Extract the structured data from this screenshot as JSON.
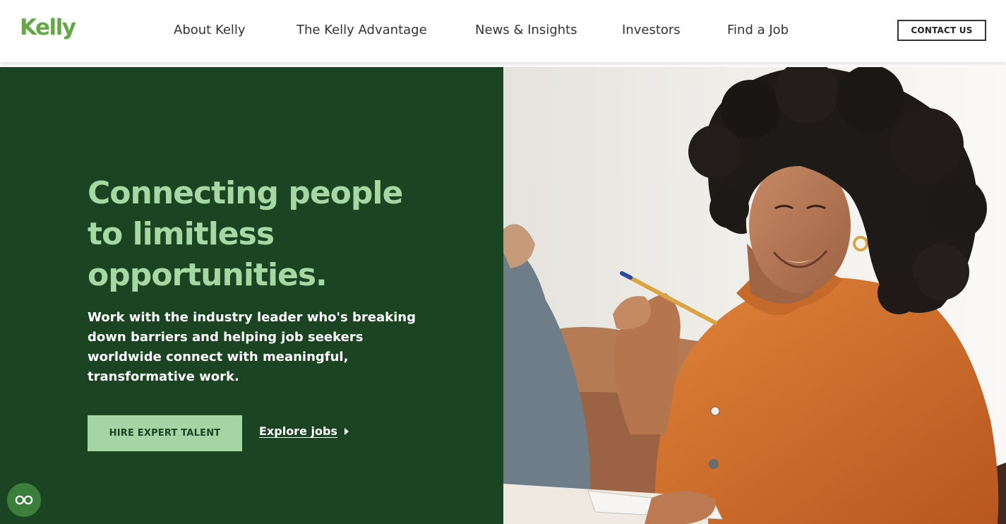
{
  "header": {
    "logo_text": "Kelly",
    "nav": [
      {
        "label": "About Kelly"
      },
      {
        "label": "The Kelly Advantage"
      },
      {
        "label": "News & Insights"
      },
      {
        "label": "Investors"
      },
      {
        "label": "Find a Job"
      }
    ],
    "contact_label": "CONTACT US"
  },
  "hero": {
    "headline": "Connecting people to limitless opportunities.",
    "subtext": "Work with the industry leader who's breaking down barriers and helping job seekers worldwide connect with meaningful, transformative work.",
    "primary_cta": "HIRE EXPERT TALENT",
    "secondary_cta": "Explore jobs",
    "image_subject": "smiling-woman-with-notebook-and-pen"
  },
  "accessibility": {
    "icon": "accessibility-glasses-icon"
  },
  "colors": {
    "brand_green": "#63a844",
    "hero_dark_green": "#1b4522",
    "headline_light_green": "#a7d7a3",
    "button_green": "#a5d4a5",
    "accessibility_green": "#3c7f3c"
  }
}
